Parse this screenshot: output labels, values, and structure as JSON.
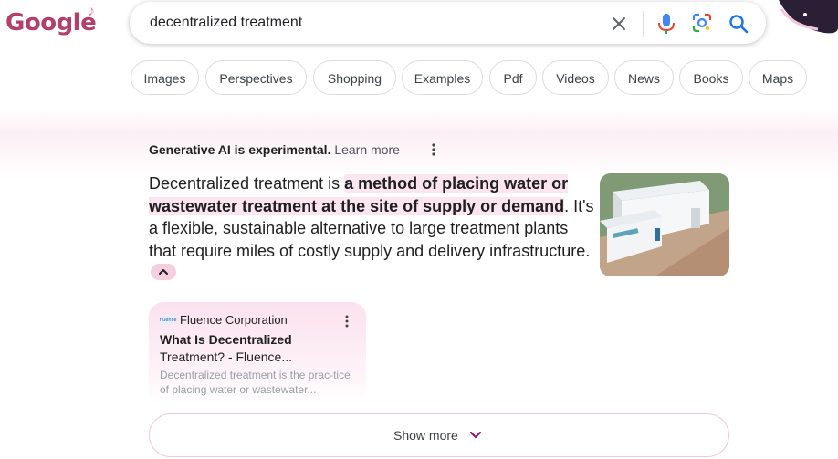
{
  "logo": {
    "text": "Google"
  },
  "search": {
    "query": "decentralized treatment"
  },
  "chips": [
    {
      "label": "Images"
    },
    {
      "label": "Perspectives"
    },
    {
      "label": "Shopping"
    },
    {
      "label": "Examples"
    },
    {
      "label": "Pdf"
    },
    {
      "label": "Videos"
    },
    {
      "label": "News"
    },
    {
      "label": "Books"
    },
    {
      "label": "Maps"
    }
  ],
  "ai_overview": {
    "experimental_label": "Generative AI is experimental.",
    "learn_more_label": "Learn more",
    "text_before": "Decentralized treatment is ",
    "text_highlight": "a method of placing water or wastewater treatment at the site of supply or demand",
    "text_after": ". It's a flexible, sustainable alternative to large treatment plants that require miles of costly supply and delivery infrastructure."
  },
  "source_card": {
    "site_name": "Fluence Corporation",
    "favicon_text": "fluence",
    "title_line1": "What Is Decentralized",
    "title_line2": "Treatment? - Fluence...",
    "snippet": "Decentralized treatment is the prac-tice of placing water or wastewater..."
  },
  "show_more": {
    "label": "Show more"
  },
  "colors": {
    "accent": "#b0416a",
    "highlight": "#fbe5ef",
    "chevron": "#8a1f6e",
    "google_blue": "#1a73e8"
  }
}
